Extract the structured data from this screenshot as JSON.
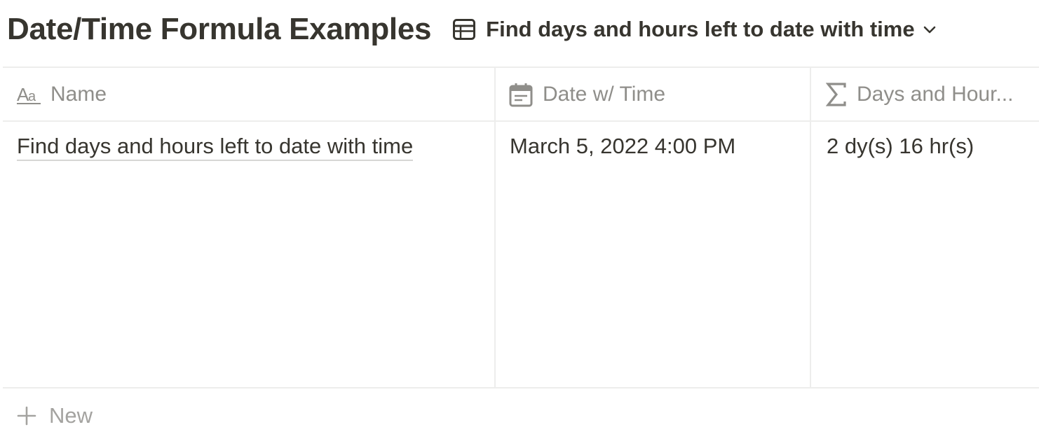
{
  "header": {
    "title": "Date/Time Formula Examples",
    "view_icon": "table-icon",
    "view_name": "Find days and hours left to date with time",
    "view_dropdown_icon": "chevron-down-icon"
  },
  "table": {
    "columns": [
      {
        "label": "Name",
        "icon": "text-property-icon"
      },
      {
        "label": "Date w/ Time",
        "icon": "calendar-icon"
      },
      {
        "label": "Days and Hour...",
        "icon": "sigma-icon"
      }
    ],
    "rows": [
      {
        "name": "Find days and hours left to date with time",
        "date_time": "March 5, 2022 4:00 PM",
        "days_and_hours": "2 dy(s) 16 hr(s)"
      }
    ]
  },
  "new_row": {
    "icon": "plus-icon",
    "label": "New"
  },
  "colors": {
    "text": "#37352f",
    "muted": "#8f8e8a",
    "border": "#ededec"
  }
}
